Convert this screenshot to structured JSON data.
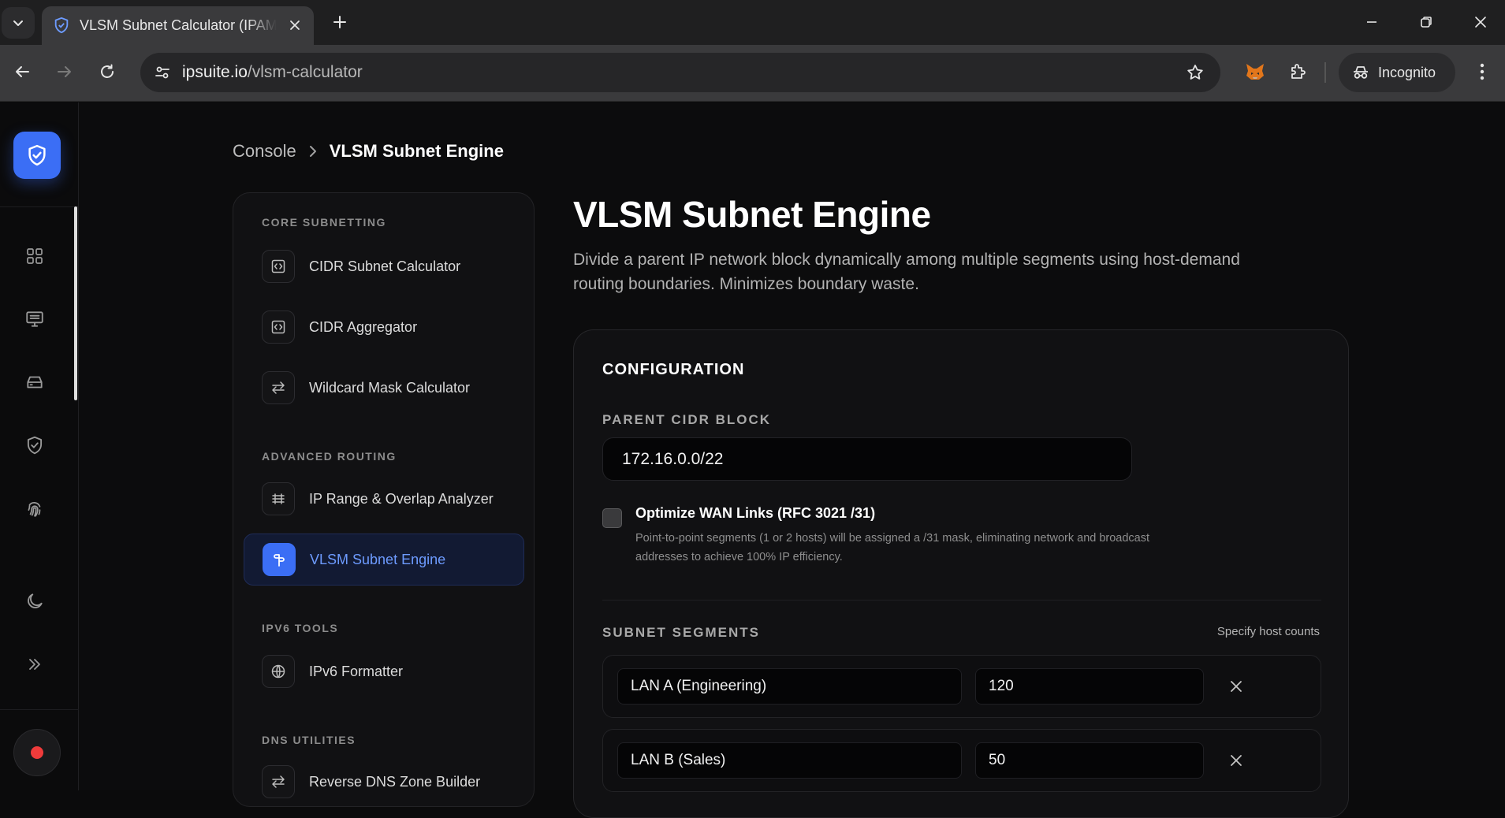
{
  "browser": {
    "tab_title": "VLSM Subnet Calculator (IPAM & ",
    "url_host": "ipsuite.io",
    "url_path": "/vlsm-calculator",
    "incognito_label": "Incognito"
  },
  "breadcrumb": {
    "root": "Console",
    "current": "VLSM Subnet Engine"
  },
  "toolnav": {
    "sections": [
      {
        "title": "CORE SUBNETTING",
        "items": [
          {
            "label": "CIDR Subnet Calculator",
            "icon": "code-brackets-icon"
          },
          {
            "label": "CIDR Aggregator",
            "icon": "code-brackets-icon"
          },
          {
            "label": "Wildcard Mask Calculator",
            "icon": "swap-arrows-icon"
          }
        ]
      },
      {
        "title": "ADVANCED ROUTING",
        "items": [
          {
            "label": "IP Range & Overlap Analyzer",
            "icon": "range-lines-icon"
          },
          {
            "label": "VLSM Subnet Engine",
            "icon": "split-icon",
            "active": true
          }
        ]
      },
      {
        "title": "IPV6 TOOLS",
        "items": [
          {
            "label": "IPv6 Formatter",
            "icon": "globe-icon"
          }
        ]
      },
      {
        "title": "DNS UTILITIES",
        "items": [
          {
            "label": "Reverse DNS Zone Builder",
            "icon": "swap-arrows-icon"
          }
        ]
      }
    ]
  },
  "main": {
    "title": "VLSM Subnet Engine",
    "description": "Divide a parent IP network block dynamically among multiple segments using host-demand routing boundaries. Minimizes boundary waste."
  },
  "config": {
    "heading": "CONFIGURATION",
    "parent_label": "PARENT CIDR BLOCK",
    "parent_value": "172.16.0.0/22",
    "optimize_title": "Optimize WAN Links (RFC 3021 /31)",
    "optimize_desc": "Point-to-point segments (1 or 2 hosts) will be assigned a /31 mask, eliminating network and broadcast addresses to achieve 100% IP efficiency.",
    "optimize_checked": false,
    "segments_label": "SUBNET SEGMENTS",
    "segments_hint": "Specify host counts",
    "segments": [
      {
        "name": "LAN A (Engineering)",
        "hosts": "120"
      },
      {
        "name": "LAN B (Sales)",
        "hosts": "50"
      }
    ]
  },
  "colors": {
    "accent": "#3b6ef5",
    "active_text": "#6d9bff",
    "record_dot": "#ef3b3b"
  }
}
